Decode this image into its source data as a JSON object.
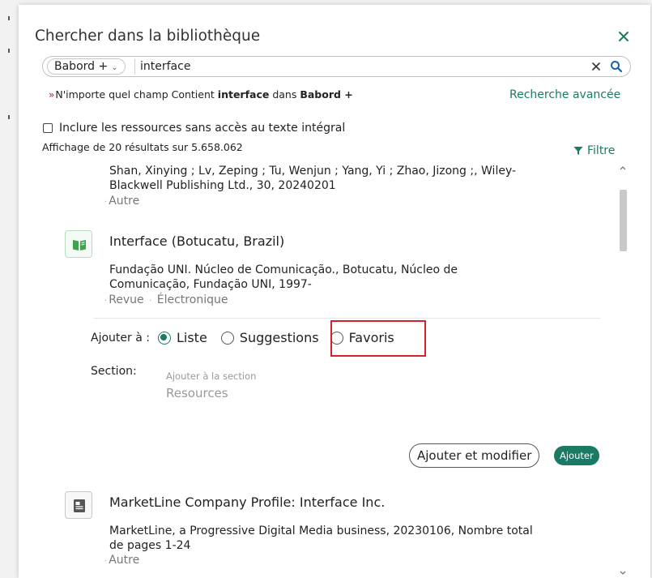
{
  "dialog": {
    "title": "Chercher dans la bibliothèque"
  },
  "search": {
    "scope": "Babord +",
    "query": "interface"
  },
  "query_summary": {
    "prefix": "N'importe quel champ Contient",
    "term": "interface",
    "connector": "dans",
    "scope": "Babord +"
  },
  "advanced_search_label": "Recherche avancée",
  "include_label": "Inclure les ressources sans accès au texte intégral",
  "results_count": "Affichage de 20 résultats sur 5.658.062",
  "filter_label": "Filtre",
  "results": [
    {
      "authors_line1": "Shan, Xinying ; Lv, Zeping ; Tu, Wenjun ; Yang, Yi ; Zhao, Jizong ;, Wiley-",
      "authors_line2": "Blackwell Publishing Ltd., 30, 20240201",
      "type": "Autre"
    },
    {
      "title": "Interface (Botucatu, Brazil)",
      "publisher_line1": "Fundação UNI. Núcleo de Comunicação., Botucatu, Núcleo de",
      "publisher_line2": "Comunicação, Fundação UNI, 1997-",
      "type": "Revue",
      "format": "Électronique",
      "add_to_label": "Ajouter à :",
      "options": [
        "Liste",
        "Suggestions",
        "Favoris"
      ],
      "selected_option": "Liste",
      "section_label": "Section:",
      "section_placeholder": "Ajouter à la section",
      "section_value": "Resources",
      "edit_button_label": "Ajouter et modifier",
      "add_button_label": "Ajouter"
    },
    {
      "title": "MarketLine Company Profile: Interface Inc.",
      "publisher_line1": "MarketLine, a Progressive Digital Media business, 20230106, Nombre total",
      "publisher_line2": "de pages 1-24",
      "type": "Autre"
    }
  ],
  "colors": {
    "accent": "#1a7a64",
    "highlight": "#d6202e",
    "arrow": "#9b1c6c"
  }
}
